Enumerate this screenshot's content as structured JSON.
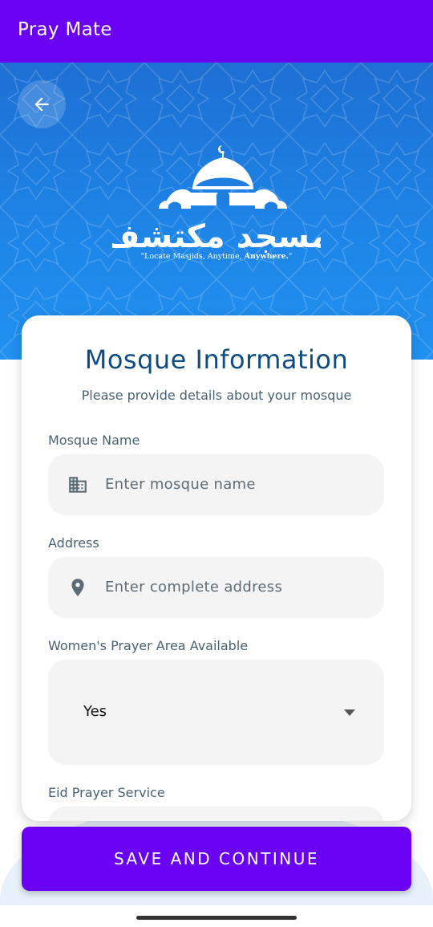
{
  "app": {
    "title": "Pray Mate"
  },
  "hero": {
    "logo_text": "مسجد مكتشف",
    "tagline_prefix": "\"Locate Masjids, Anytime, ",
    "tagline_bold": "Anywhere.",
    "tagline_suffix": "\""
  },
  "card": {
    "title": "Mosque Information",
    "subtitle": "Please provide details about your mosque",
    "fields": [
      {
        "label": "Mosque Name",
        "placeholder": "Enter mosque name",
        "icon": "building-icon"
      },
      {
        "label": "Address",
        "placeholder": "Enter complete address",
        "icon": "location-pin-icon"
      },
      {
        "label": "Women's Prayer Area Available",
        "value": "Yes"
      },
      {
        "label": "Eid Prayer Service"
      }
    ]
  },
  "actions": {
    "save_label": "SAVE AND CONTINUE"
  },
  "colors": {
    "primary": "#6a00f4",
    "hero_blue": "#1e86e8",
    "title_blue": "#0f4c81"
  }
}
